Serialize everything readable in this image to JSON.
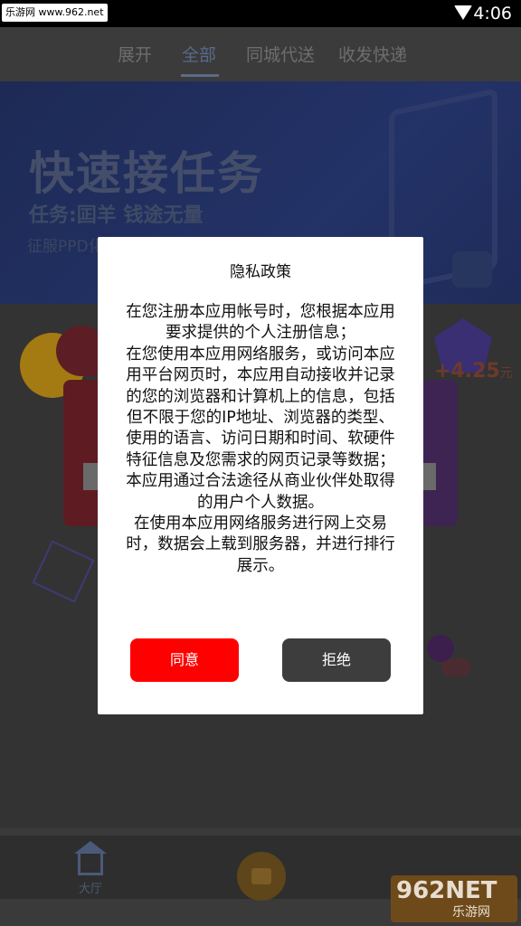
{
  "status_bar": {
    "watermark": "乐游网 www.962.net",
    "time": "4:06"
  },
  "tabs": [
    {
      "label": "展开",
      "active": false
    },
    {
      "label": "全部",
      "active": true
    },
    {
      "label": "同城代送",
      "active": false
    },
    {
      "label": "收发快递",
      "active": false
    }
  ],
  "banner": {
    "title": "快速接任务",
    "subtitle": "任务:囸羊  钱途无量",
    "subtitle2": "征服PPD化"
  },
  "reward": {
    "amount": "+4.25",
    "unit": "元"
  },
  "bottom_nav": {
    "home_label": "大厅"
  },
  "watermark_bottom": {
    "top": "962NET",
    "bottom": "乐游网"
  },
  "privacy_dialog": {
    "title": "隐私政策",
    "body_lines": [
      "在您注册本应用帐号时，您根据本应用",
      "要求提供的个人注册信息；",
      "在您使用本应用网络服务，或访问本应",
      "用平台网页时，本应用自动接收并记录",
      "的您的浏览器和计算机上的信息，包括",
      "但不限于您的IP地址、浏览器的类型、",
      "使用的语言、访问日期和时间、软硬件",
      "特征信息及您需求的网页记录等数据；",
      "本应用通过合法途径从商业伙伴处取得",
      "的用户个人数据。",
      "在使用本应用网络服务进行网上交易",
      "时，数据会上载到服务器，并进行排行",
      "展示。"
    ],
    "agree_label": "同意",
    "refuse_label": "拒绝"
  },
  "colors": {
    "agree": "#ff0000",
    "refuse": "#3d3d3d",
    "overlay_dim": "#000000"
  }
}
